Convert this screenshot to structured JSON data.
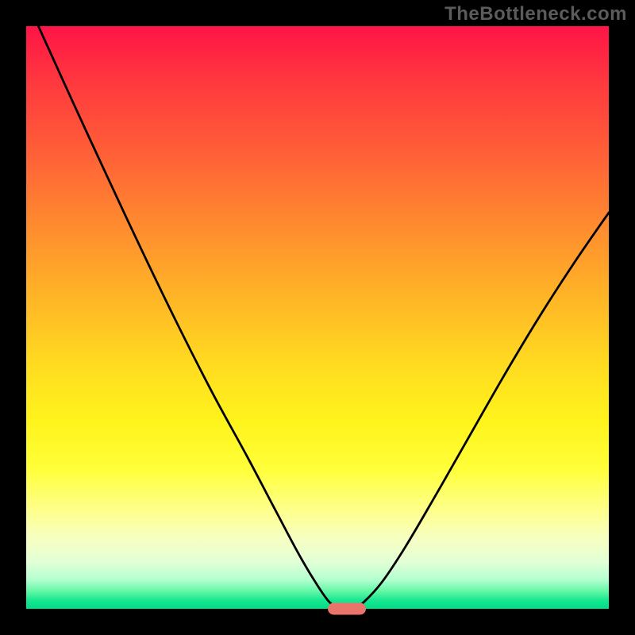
{
  "watermark": "TheBottleneck.com",
  "chart_data": {
    "type": "line",
    "title": "",
    "xlabel": "",
    "ylabel": "",
    "xlim": [
      0,
      1
    ],
    "ylim": [
      0,
      1
    ],
    "series": [
      {
        "name": "curve",
        "points": [
          {
            "x": 0.021,
            "y": 1.0
          },
          {
            "x": 0.08,
            "y": 0.87
          },
          {
            "x": 0.14,
            "y": 0.74
          },
          {
            "x": 0.2,
            "y": 0.612
          },
          {
            "x": 0.26,
            "y": 0.488
          },
          {
            "x": 0.32,
            "y": 0.37
          },
          {
            "x": 0.38,
            "y": 0.26
          },
          {
            "x": 0.43,
            "y": 0.165
          },
          {
            "x": 0.47,
            "y": 0.09
          },
          {
            "x": 0.5,
            "y": 0.04
          },
          {
            "x": 0.52,
            "y": 0.012
          },
          {
            "x": 0.535,
            "y": 0.003
          },
          {
            "x": 0.55,
            "y": 0.0
          },
          {
            "x": 0.565,
            "y": 0.003
          },
          {
            "x": 0.58,
            "y": 0.012
          },
          {
            "x": 0.61,
            "y": 0.045
          },
          {
            "x": 0.65,
            "y": 0.105
          },
          {
            "x": 0.7,
            "y": 0.19
          },
          {
            "x": 0.76,
            "y": 0.295
          },
          {
            "x": 0.82,
            "y": 0.4
          },
          {
            "x": 0.88,
            "y": 0.5
          },
          {
            "x": 0.94,
            "y": 0.593
          },
          {
            "x": 1.0,
            "y": 0.68
          }
        ]
      }
    ],
    "marker": {
      "x": 0.55,
      "y": 0.0
    },
    "gradient_colors": {
      "top": "#ff1446",
      "mid": "#ffe020",
      "bottom": "#00dd86"
    }
  }
}
